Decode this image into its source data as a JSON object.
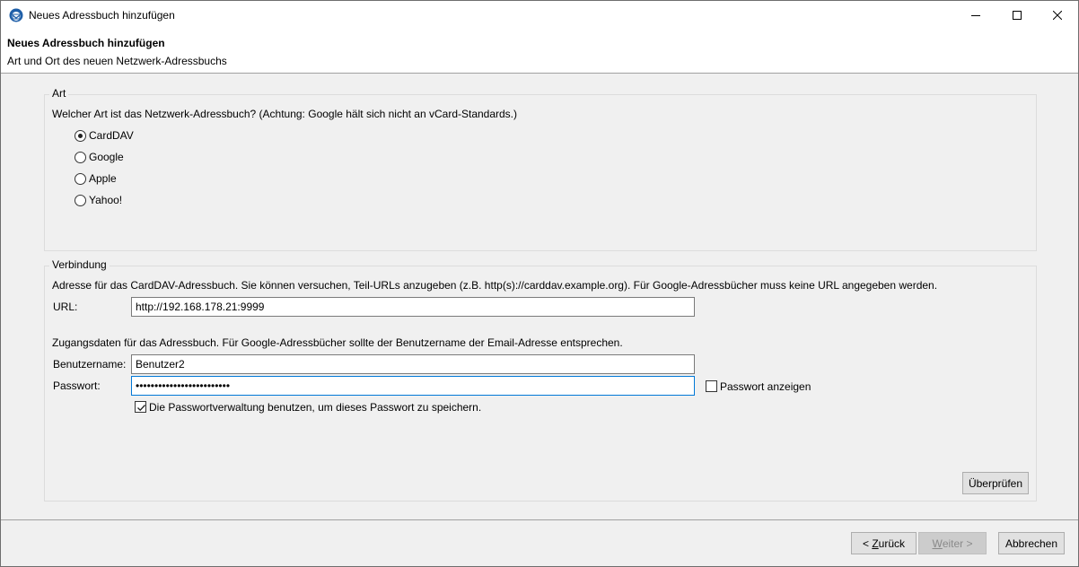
{
  "window": {
    "title": "Neues Adressbuch hinzufügen"
  },
  "header": {
    "title": "Neues Adressbuch hinzufügen",
    "subtitle": "Art und Ort des neuen Netzwerk-Adressbuchs"
  },
  "art_group": {
    "label": "Art",
    "question": "Welcher Art ist das Netzwerk-Adressbuch? (Achtung: Google hält sich nicht an vCard-Standards.)",
    "options": [
      {
        "label": "CardDAV",
        "checked": true
      },
      {
        "label": "Google",
        "checked": false
      },
      {
        "label": "Apple",
        "checked": false
      },
      {
        "label": "Yahoo!",
        "checked": false
      }
    ]
  },
  "connection_group": {
    "label": "Verbindung",
    "address_hint": "Adresse für das CardDAV-Adressbuch. Sie können versuchen, Teil-URLs anzugeben (z.B. http(s)://carddav.example.org). Für Google-Adressbücher muss keine URL angegeben werden.",
    "url_label": "URL:",
    "url_value": "http://192.168.178.21:9999",
    "credentials_hint": "Zugangsdaten für das Adressbuch. Für Google-Adressbücher sollte der Benutzername der Email-Adresse entsprechen.",
    "username_label": "Benutzername:",
    "username_value": "Benutzer2",
    "password_label": "Passwort:",
    "password_value": "•••••••••••••••••••••••••",
    "show_password_label": "Passwort anzeigen",
    "show_password_checked": false,
    "use_password_manager_label": "Die Passwortverwaltung benutzen, um dieses Passwort zu speichern.",
    "use_password_manager_checked": true,
    "verify_button": "Überprüfen"
  },
  "footer": {
    "back_button_prefix": "< ",
    "back_button_mnemonic": "Z",
    "back_button_rest": "urück",
    "next_button_mnemonic": "W",
    "next_button_rest": "eiter >",
    "cancel_button": "Abbrechen"
  },
  "colors": {
    "focus_border": "#0078d7",
    "background": "#f0f0f0"
  }
}
